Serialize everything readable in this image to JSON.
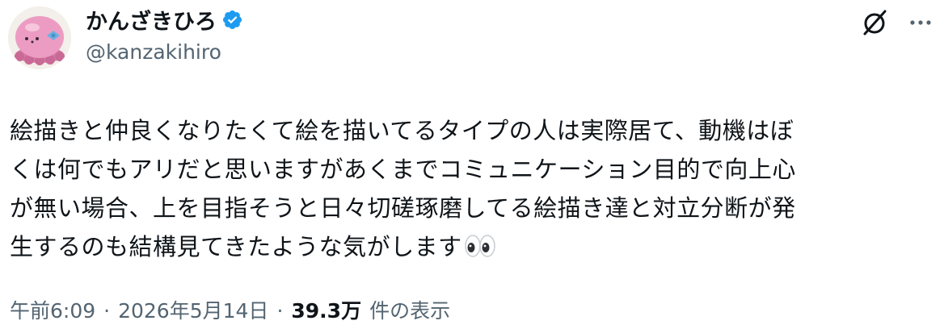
{
  "author": {
    "display_name": "かんざきひろ",
    "handle": "@kanzakihiro",
    "verified": true,
    "avatar_icon": "octopus-avatar-icon"
  },
  "header_actions": {
    "grok_icon": "grok-icon",
    "more_icon": "more-options-icon"
  },
  "post": {
    "lines": [
      "絵描きと仲良くなりたくて絵を描いてるタイプの人は実際居て、動機はぼ",
      "くは何でもアリだと思いますがあくまでコミュニケーション目的で向上心",
      "が無い場合、上を目指そうと日々切磋琢磨してる絵描き達と対立分断が発",
      "生するのも結構見てきたような気がします"
    ],
    "trailing_emoji": "eyes-emoji"
  },
  "meta": {
    "time": "午前6:09",
    "separator": "·",
    "date": "2026年5月14日",
    "views_count": "39.3万",
    "views_label": "件の表示"
  },
  "colors": {
    "text_primary": "#0f1419",
    "text_secondary": "#536471",
    "verified_blue": "#1d9bf0",
    "avatar_pink": "#e88fb8"
  }
}
